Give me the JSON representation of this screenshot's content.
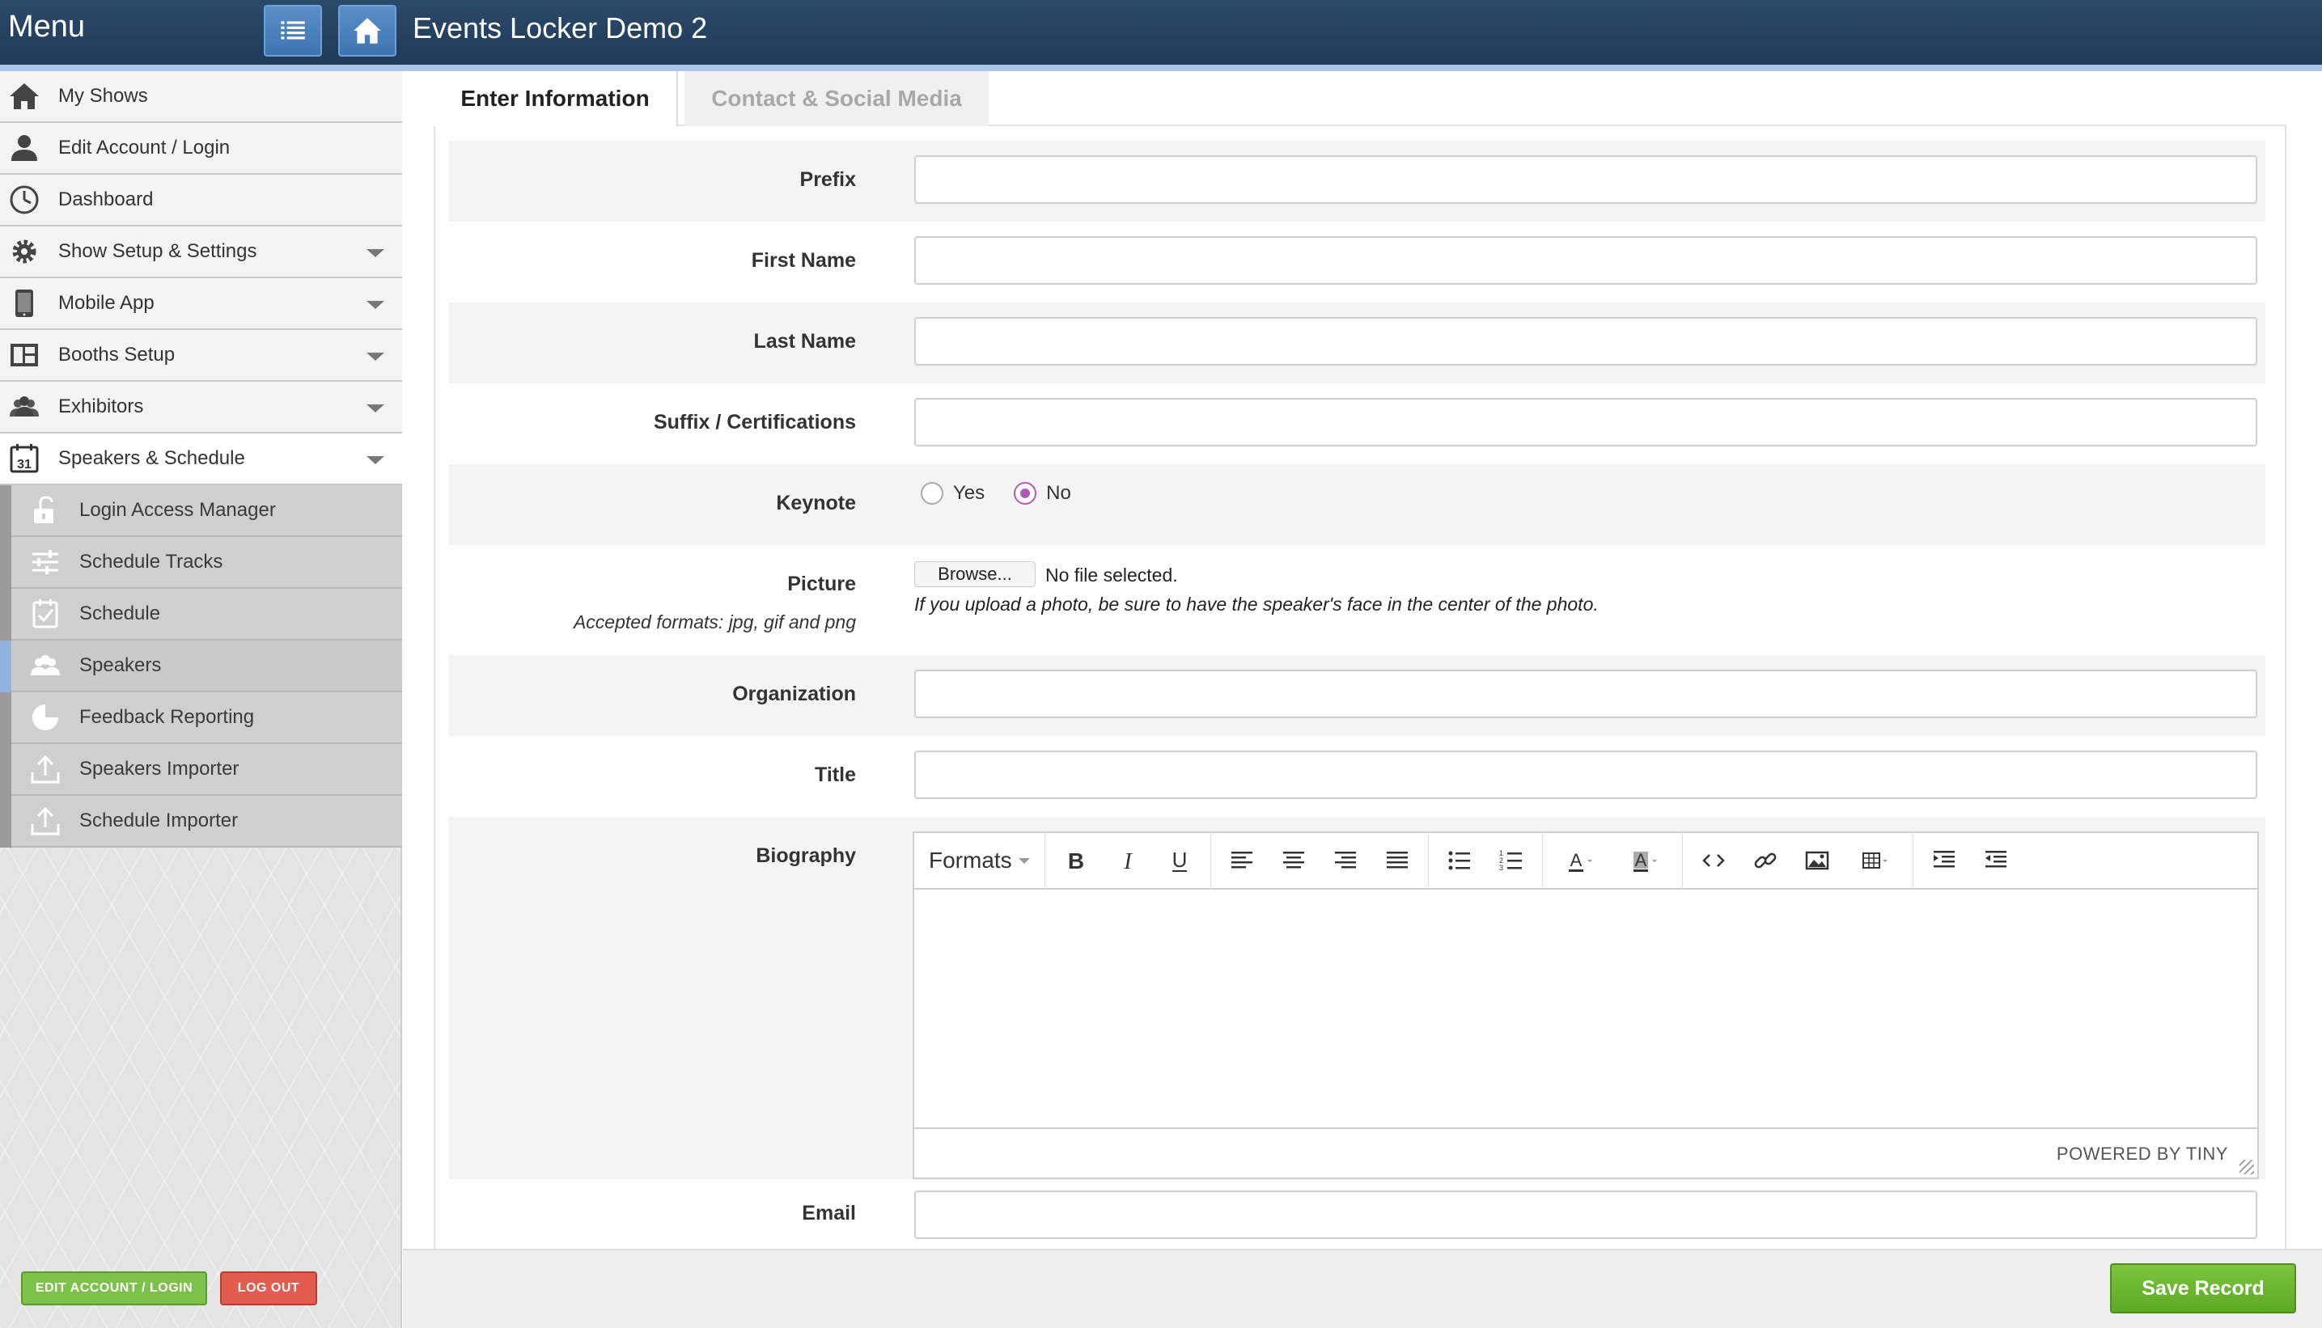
{
  "header": {
    "menu_label": "Menu",
    "app_title": "Events Locker Demo 2"
  },
  "sidebar": {
    "items": [
      {
        "label": "My Shows",
        "icon": "home-icon"
      },
      {
        "label": "Edit Account / Login",
        "icon": "user-icon"
      },
      {
        "label": "Dashboard",
        "icon": "dashboard-clock-icon"
      },
      {
        "label": "Show Setup & Settings",
        "icon": "gear-icon"
      },
      {
        "label": "Mobile App",
        "icon": "tablet-icon"
      },
      {
        "label": "Booths Setup",
        "icon": "booth-layout-icon"
      },
      {
        "label": "Exhibitors",
        "icon": "people-icon"
      },
      {
        "label": "Speakers & Schedule",
        "icon": "calendar-icon",
        "calendar_day": "31"
      }
    ],
    "sub_items": [
      {
        "label": "Login Access Manager",
        "icon": "unlock-icon"
      },
      {
        "label": "Schedule Tracks",
        "icon": "sliders-icon"
      },
      {
        "label": "Schedule",
        "icon": "checklist-icon"
      },
      {
        "label": "Speakers",
        "icon": "people-icon"
      },
      {
        "label": "Feedback Reporting",
        "icon": "pie-chart-icon"
      },
      {
        "label": "Speakers Importer",
        "icon": "upload-icon"
      },
      {
        "label": "Schedule Importer",
        "icon": "upload-icon"
      }
    ],
    "edit_account_button": "EDIT ACCOUNT / LOGIN",
    "logout_button": "LOG OUT"
  },
  "tabs": {
    "active": "Enter Information",
    "inactive": "Contact & Social Media"
  },
  "form": {
    "prefix_label": "Prefix",
    "first_name_label": "First Name",
    "last_name_label": "Last Name",
    "suffix_label": "Suffix / Certifications",
    "keynote_label": "Keynote",
    "keynote_yes": "Yes",
    "keynote_no": "No",
    "keynote_value": "No",
    "picture_label": "Picture",
    "picture_formats": "Accepted formats: jpg, gif and png",
    "browse_button": "Browse...",
    "no_file": "No file selected.",
    "picture_hint": "If you upload a photo, be sure to have the speaker's face in the center of the photo.",
    "organization_label": "Organization",
    "title_label": "Title",
    "biography_label": "Biography",
    "email_label": "Email"
  },
  "editor": {
    "formats_label": "Formats",
    "powered_by": "POWERED BY TINY"
  },
  "footer": {
    "save_button": "Save Record"
  },
  "colors": {
    "header_bg": "#24425f",
    "header_accent_line": "#a9c8e8",
    "radio_checked": "#b05ab8",
    "save_green": "#6cb630",
    "logout_red": "#e25c4f"
  }
}
